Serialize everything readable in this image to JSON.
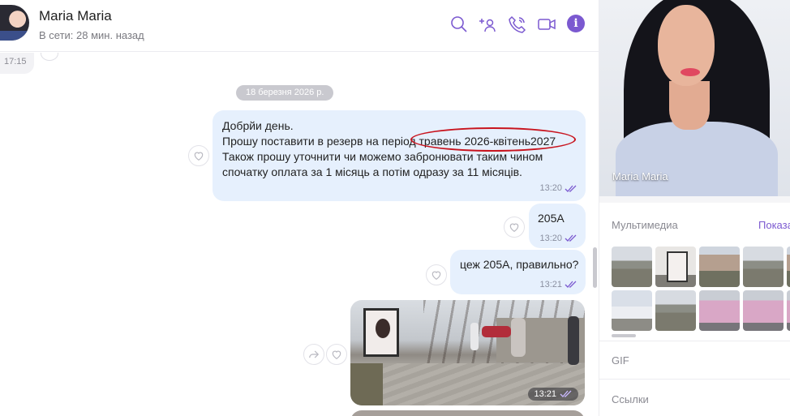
{
  "header": {
    "contact_name": "Maria Maria",
    "status": "В сети: 28 мин. назад",
    "icons": [
      "search-icon",
      "add-participant-icon",
      "call-icon",
      "video-call-icon",
      "info-icon"
    ],
    "info_glyph": "i"
  },
  "chat": {
    "prev_time": "17:15",
    "date_separator": "18 березня 2026 р.",
    "messages": [
      {
        "lines": [
          "Добрйи день.",
          "Прошу поставити в резерв на період травень 2026-квітень2027",
          "Також прошу уточнити чи можемо забронювати таким чином",
          "спочатку оплата за 1 місяць а потім одразу за 11 місяців."
        ],
        "time": "13:20"
      },
      {
        "text": "205А",
        "time": "13:20"
      },
      {
        "text": "цеж 205А, правильно?",
        "time": "13:21"
      },
      {
        "type": "photo",
        "time": "13:21"
      }
    ]
  },
  "panel": {
    "profile_name": "Maria Maria",
    "media_label": "Мультимедиа",
    "show_label": "Показа",
    "gif_label": "GIF",
    "links_label": "Ссылки"
  },
  "colors": {
    "accent": "#7b59d0",
    "bubble": "#e6f0fd",
    "annotation": "#c8141e"
  }
}
